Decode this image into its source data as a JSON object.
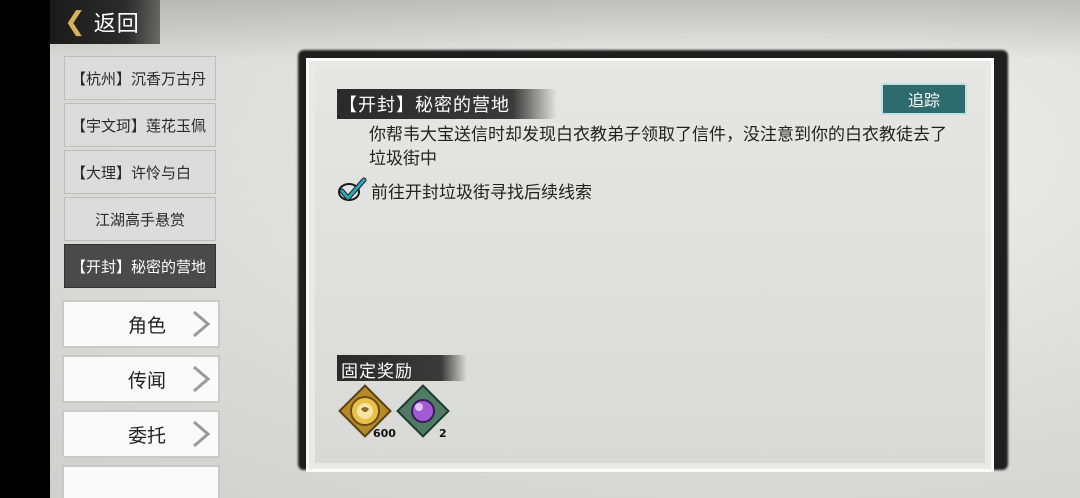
{
  "nav": {
    "back_label": "返回"
  },
  "quest_list": [
    {
      "label": "【杭州】沉香万古丹",
      "active": false
    },
    {
      "label": "【宇文珂】莲花玉佩",
      "active": false
    },
    {
      "label": "【大理】许怜与白",
      "active": false
    },
    {
      "label": "江湖高手悬赏",
      "active": false
    },
    {
      "label": "【开封】秘密的营地",
      "active": true
    }
  ],
  "categories": [
    {
      "label": "角色"
    },
    {
      "label": "传闻"
    },
    {
      "label": "委托"
    }
  ],
  "quest_detail": {
    "title": "【开封】秘密的营地",
    "track_label": "追踪",
    "description": "你帮韦大宝送信时却发现白衣教弟子领取了信件，没注意到你的白衣教徒去了垃圾街中",
    "objective": "前往开封垃圾街寻找后续线索",
    "rewards_title": "固定奖励",
    "rewards": [
      {
        "icon": "gold-coin-icon",
        "count": "600"
      },
      {
        "icon": "purple-orb-icon",
        "count": "2"
      }
    ]
  },
  "colors": {
    "accent": "#2d6b6e",
    "active_bg": "#4a4a4a",
    "check": "#2aa8b8"
  }
}
